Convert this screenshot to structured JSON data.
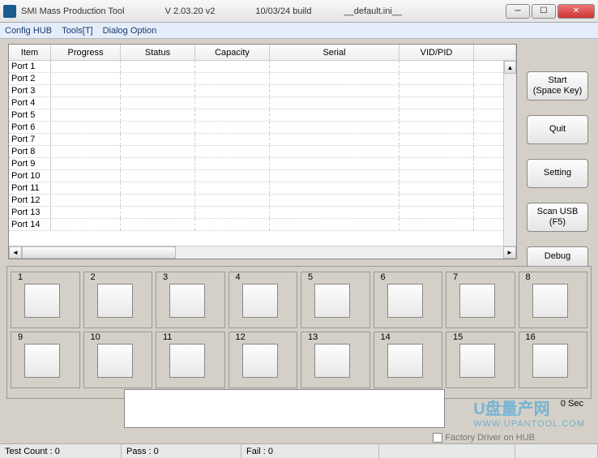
{
  "title": {
    "app": "SMI Mass Production Tool",
    "version": "V 2.03.20    v2",
    "build": "10/03/24 build",
    "ini": "__default.ini__"
  },
  "menu": {
    "config_hub": "Config HUB",
    "tools": "Tools[T]",
    "dialog_option": "Dialog Option"
  },
  "columns": {
    "item": "Item",
    "progress": "Progress",
    "status": "Status",
    "capacity": "Capacity",
    "serial": "Serial",
    "vidpid": "VID/PID"
  },
  "ports": [
    "Port 1",
    "Port 2",
    "Port 3",
    "Port 4",
    "Port 5",
    "Port 6",
    "Port 7",
    "Port 8",
    "Port 9",
    "Port 10",
    "Port 11",
    "Port 12",
    "Port 13",
    "Port 14"
  ],
  "buttons": {
    "start_l1": "Start",
    "start_l2": "(Space Key)",
    "quit": "Quit",
    "setting": "Setting",
    "scan_l1": "Scan USB",
    "scan_l2": "(F5)",
    "debug": "Debug"
  },
  "grid_numbers": [
    "1",
    "2",
    "3",
    "4",
    "5",
    "6",
    "7",
    "8",
    "9",
    "10",
    "11",
    "12",
    "13",
    "14",
    "15",
    "16"
  ],
  "timer": "0 Sec",
  "checkbox_label": "Factory Driver on HUB",
  "status": {
    "test_count": "Test Count : 0",
    "pass": "Pass : 0",
    "fail": "Fail : 0"
  },
  "watermark": {
    "text": "U盘量产网",
    "url": "WWW.UPANTOOL.COM"
  }
}
